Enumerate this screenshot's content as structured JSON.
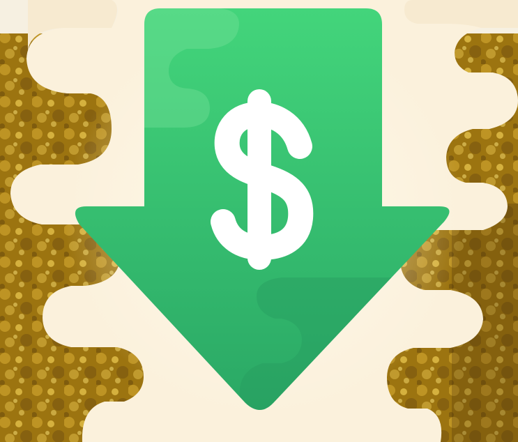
{
  "image": {
    "subject": "green-down-arrow-dollar-icon",
    "icon_glyph": "$",
    "colors": {
      "gold_glitter_base": "#9c7410",
      "gold_glitter_light": "#d7b13c",
      "gold_glitter_dark": "#5a3f0b",
      "cream_wave": "#fbf1dc",
      "cream_wave_edge": "#f7ead0",
      "arrow_top": "#43d57b",
      "arrow_bottom": "#2aa865",
      "arrow_shadow": "#2b9f62",
      "arrow_highlight": "#78e49c",
      "dollar_white": "#ffffff"
    }
  }
}
